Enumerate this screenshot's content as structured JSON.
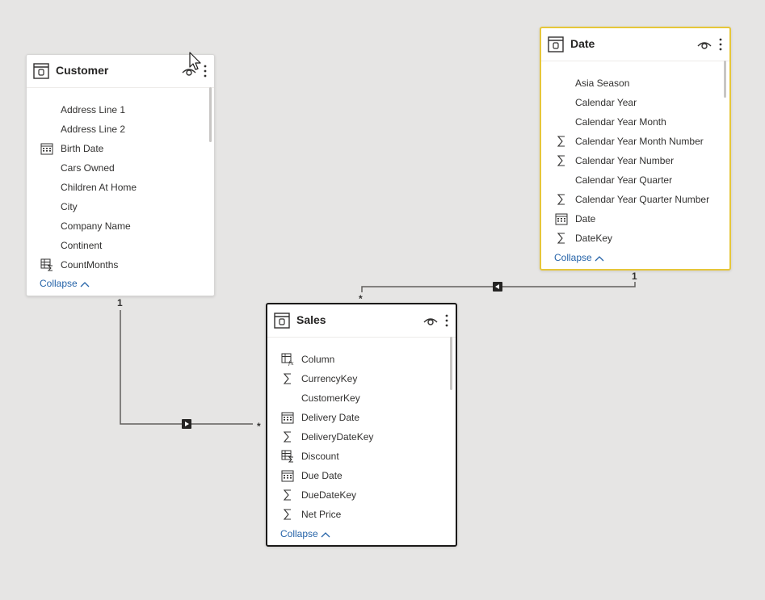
{
  "tables": {
    "customer": {
      "title": "Customer",
      "fields": [
        {
          "name": "Address Line 1",
          "icon": "none"
        },
        {
          "name": "Address Line 2",
          "icon": "none"
        },
        {
          "name": "Birth Date",
          "icon": "calendar-icon"
        },
        {
          "name": "Cars Owned",
          "icon": "none"
        },
        {
          "name": "Children At Home",
          "icon": "none"
        },
        {
          "name": "City",
          "icon": "none"
        },
        {
          "name": "Company Name",
          "icon": "none"
        },
        {
          "name": "Continent",
          "icon": "none"
        },
        {
          "name": "CountMonths",
          "icon": "measure-icon"
        }
      ],
      "collapse_label": "Collapse"
    },
    "date": {
      "title": "Date",
      "fields": [
        {
          "name": "Asia Season",
          "icon": "none"
        },
        {
          "name": "Calendar Year",
          "icon": "none"
        },
        {
          "name": "Calendar Year Month",
          "icon": "none"
        },
        {
          "name": "Calendar Year Month Number",
          "icon": "sigma-icon"
        },
        {
          "name": "Calendar Year Number",
          "icon": "sigma-icon"
        },
        {
          "name": "Calendar Year Quarter",
          "icon": "none"
        },
        {
          "name": "Calendar Year Quarter Number",
          "icon": "sigma-icon"
        },
        {
          "name": "Date",
          "icon": "calendar-icon"
        },
        {
          "name": "DateKey",
          "icon": "sigma-icon"
        }
      ],
      "collapse_label": "Collapse"
    },
    "sales": {
      "title": "Sales",
      "fields": [
        {
          "name": "Column",
          "icon": "calculated-column-icon"
        },
        {
          "name": "CurrencyKey",
          "icon": "sigma-icon"
        },
        {
          "name": "CustomerKey",
          "icon": "none"
        },
        {
          "name": "Delivery Date",
          "icon": "calendar-icon"
        },
        {
          "name": "DeliveryDateKey",
          "icon": "sigma-icon"
        },
        {
          "name": "Discount",
          "icon": "measure-icon"
        },
        {
          "name": "Due Date",
          "icon": "calendar-icon"
        },
        {
          "name": "DueDateKey",
          "icon": "sigma-icon"
        },
        {
          "name": "Net Price",
          "icon": "sigma-icon"
        }
      ],
      "collapse_label": "Collapse"
    }
  },
  "relationships": {
    "customer_sales": {
      "one_label": "1",
      "many_label": "*"
    },
    "date_sales": {
      "one_label": "1",
      "many_label": "*"
    }
  },
  "colors": {
    "canvas": "#e6e5e4",
    "selected_border": "#e6c63a",
    "focused_border": "#1b1a19",
    "link": "#2563a8",
    "relationship_line": "#605e5c"
  }
}
